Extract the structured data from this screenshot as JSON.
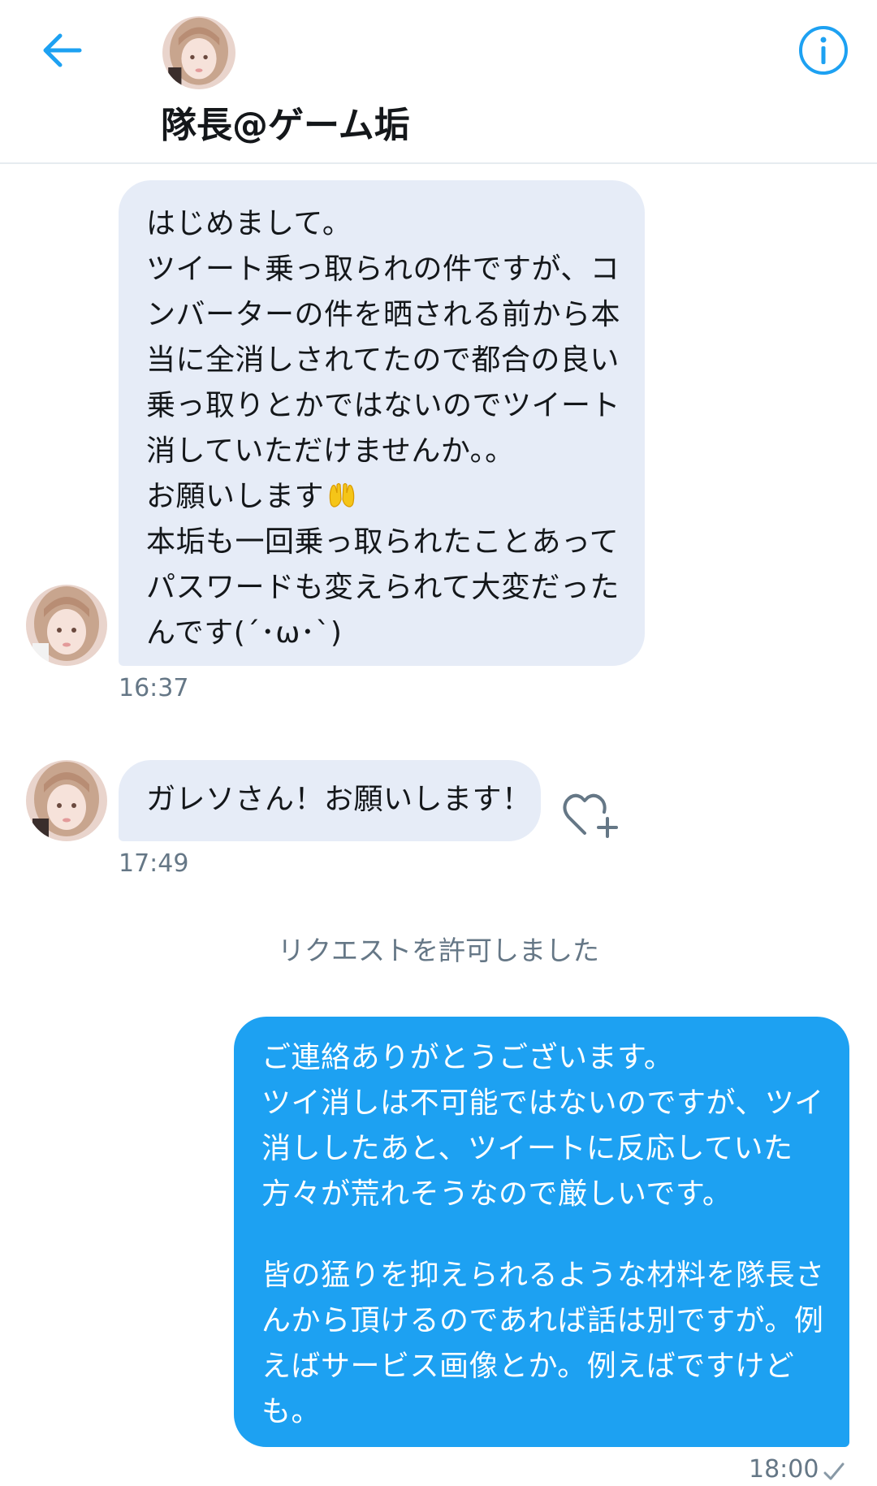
{
  "header": {
    "name": "隊長@ゲーム垢",
    "back_icon": "arrow-left-icon",
    "info_icon": "info-circle-icon"
  },
  "colors": {
    "accent": "#1da1f2",
    "incoming_bubble": "#e6ecf7",
    "timestamp": "#657786"
  },
  "messages": [
    {
      "direction": "incoming",
      "lines": [
        "はじめまして。",
        "ツイート乗っ取られの件ですが、コ",
        "ンバーターの件を晒される前から本",
        "当に全消しされてたので都合の良い",
        "乗っ取りとかではないのでツイート",
        "消していただけませんか。。",
        "お願いします",
        "本垢も一回乗っ取られたことあって",
        "パスワードも変えられて大変だった",
        "んです(´･ω･`)"
      ],
      "emoji": "raised-hands-emoji",
      "time": "16:37"
    },
    {
      "direction": "incoming",
      "lines": [
        "ガレソさん！お願いします！"
      ],
      "like_icon": "heart-plus-icon",
      "time": "17:49"
    },
    {
      "direction": "outgoing",
      "lines": [
        "ご連絡ありがとうございます。",
        "ツイ消しは不可能ではないのですが、ツイ",
        "消ししたあと、ツイートに反応していた",
        "方々が荒れそうなので厳しいです。",
        "",
        "皆の猛りを抑えられるような材料を隊長さ",
        "んから頂けるのであれば話は別ですが。例",
        "えばサービス画像とか。例えばですけど",
        "も。"
      ],
      "time": "18:00",
      "status_icon": "check-icon"
    }
  ],
  "system_message": "リクエストを許可しました"
}
